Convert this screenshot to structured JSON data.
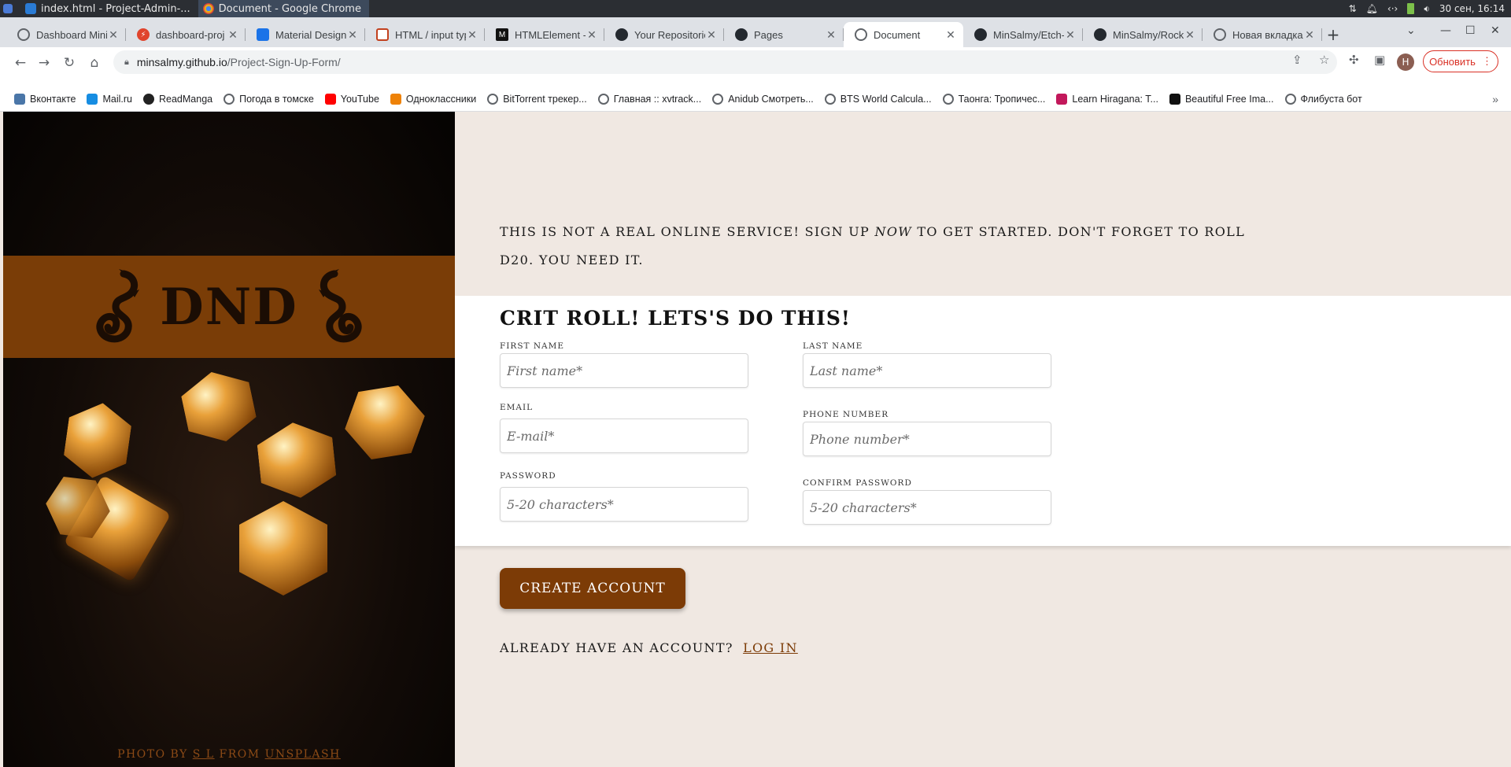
{
  "taskbar": {
    "apps": [
      {
        "label": "index.html - Project-Admin-...",
        "icon": "vscode-icon",
        "color": "#2a7bd4"
      },
      {
        "label": "Document - Google Chrome",
        "icon": "chrome-icon",
        "color": "#e8a91d"
      }
    ],
    "datetime": "30 сен, 16:14"
  },
  "browser": {
    "tabs": [
      {
        "title": "Dashboard Mini",
        "icon": "globe-icon",
        "color": "#5f6368"
      },
      {
        "title": "dashboard-proj",
        "icon": "codepen-icon",
        "color": "#e0442c"
      },
      {
        "title": "Material Design",
        "icon": "material-icon",
        "color": "#1a73e8"
      },
      {
        "title": "HTML / input type",
        "icon": "html-icon",
        "color": "#c2411e"
      },
      {
        "title": "HTMLElement -",
        "icon": "mdn-icon",
        "color": "#111111"
      },
      {
        "title": "Your Repositories",
        "icon": "github-icon",
        "color": "#24292f"
      },
      {
        "title": "Pages",
        "icon": "github-icon",
        "color": "#24292f"
      },
      {
        "title": "Document",
        "icon": "globe-icon",
        "color": "#5f6368",
        "active": true
      },
      {
        "title": "MinSalmy/Etch-",
        "icon": "github-icon",
        "color": "#24292f"
      },
      {
        "title": "MinSalmy/Rock",
        "icon": "github-icon",
        "color": "#24292f"
      },
      {
        "title": "Новая вкладка",
        "icon": "chrome-icon",
        "color": "#5f6368"
      }
    ],
    "url_domain": "minsalmy.github.io",
    "url_path": "/Project-Sign-Up-Form/",
    "update_label": "Обновить",
    "avatar_letter": "Н",
    "bookmarks": [
      {
        "label": "Вконтакте",
        "color": "#4a76a8"
      },
      {
        "label": "Mail.ru",
        "color": "#168de2"
      },
      {
        "label": "ReadManga",
        "color": "#222222"
      },
      {
        "label": "Погода в томске",
        "color": "#5f6368"
      },
      {
        "label": "YouTube",
        "color": "#ff0000"
      },
      {
        "label": "Одноклассники",
        "color": "#ee8208"
      },
      {
        "label": "BitTorrent трекер...",
        "color": "#5f6368"
      },
      {
        "label": "Главная :: xvtrack...",
        "color": "#5f6368"
      },
      {
        "label": "Anidub Смотреть...",
        "color": "#5f6368"
      },
      {
        "label": "BTS World Calcula...",
        "color": "#5f6368"
      },
      {
        "label": "Таонга: Тропичес...",
        "color": "#5f6368"
      },
      {
        "label": "Learn Hiragana: T...",
        "color": "#c2185b"
      },
      {
        "label": "Beautiful Free Ima...",
        "color": "#111111"
      },
      {
        "label": "Флибуста бот",
        "color": "#5f6368"
      }
    ]
  },
  "page": {
    "logo_text": "DND",
    "credit": {
      "prefix": "PHOTO BY",
      "author": "S L",
      "middle": "FROM",
      "source": "UNSPLASH"
    },
    "intro": {
      "part1": "This is not a real online service! Sign up",
      "emph": "now",
      "part2": "to get started. Don't forget to roll d20. You need it."
    },
    "form_title": "Crit Roll! Lets's do this!",
    "fields": {
      "first_name": {
        "label": "First name",
        "placeholder": "First name*"
      },
      "last_name": {
        "label": "Last name",
        "placeholder": "Last name*"
      },
      "email": {
        "label": "Email",
        "placeholder": "E-mail*"
      },
      "phone": {
        "label": "Phone number",
        "placeholder": "Phone number*"
      },
      "password": {
        "label": "Password",
        "placeholder": "5-20 characters*"
      },
      "confirm_password": {
        "label": "Confirm password",
        "placeholder": "5-20 characters*"
      }
    },
    "create_button": "Create account",
    "login_prompt": "Already have an account?",
    "login_link": "Log in",
    "accent_color": "#7c3b06"
  }
}
